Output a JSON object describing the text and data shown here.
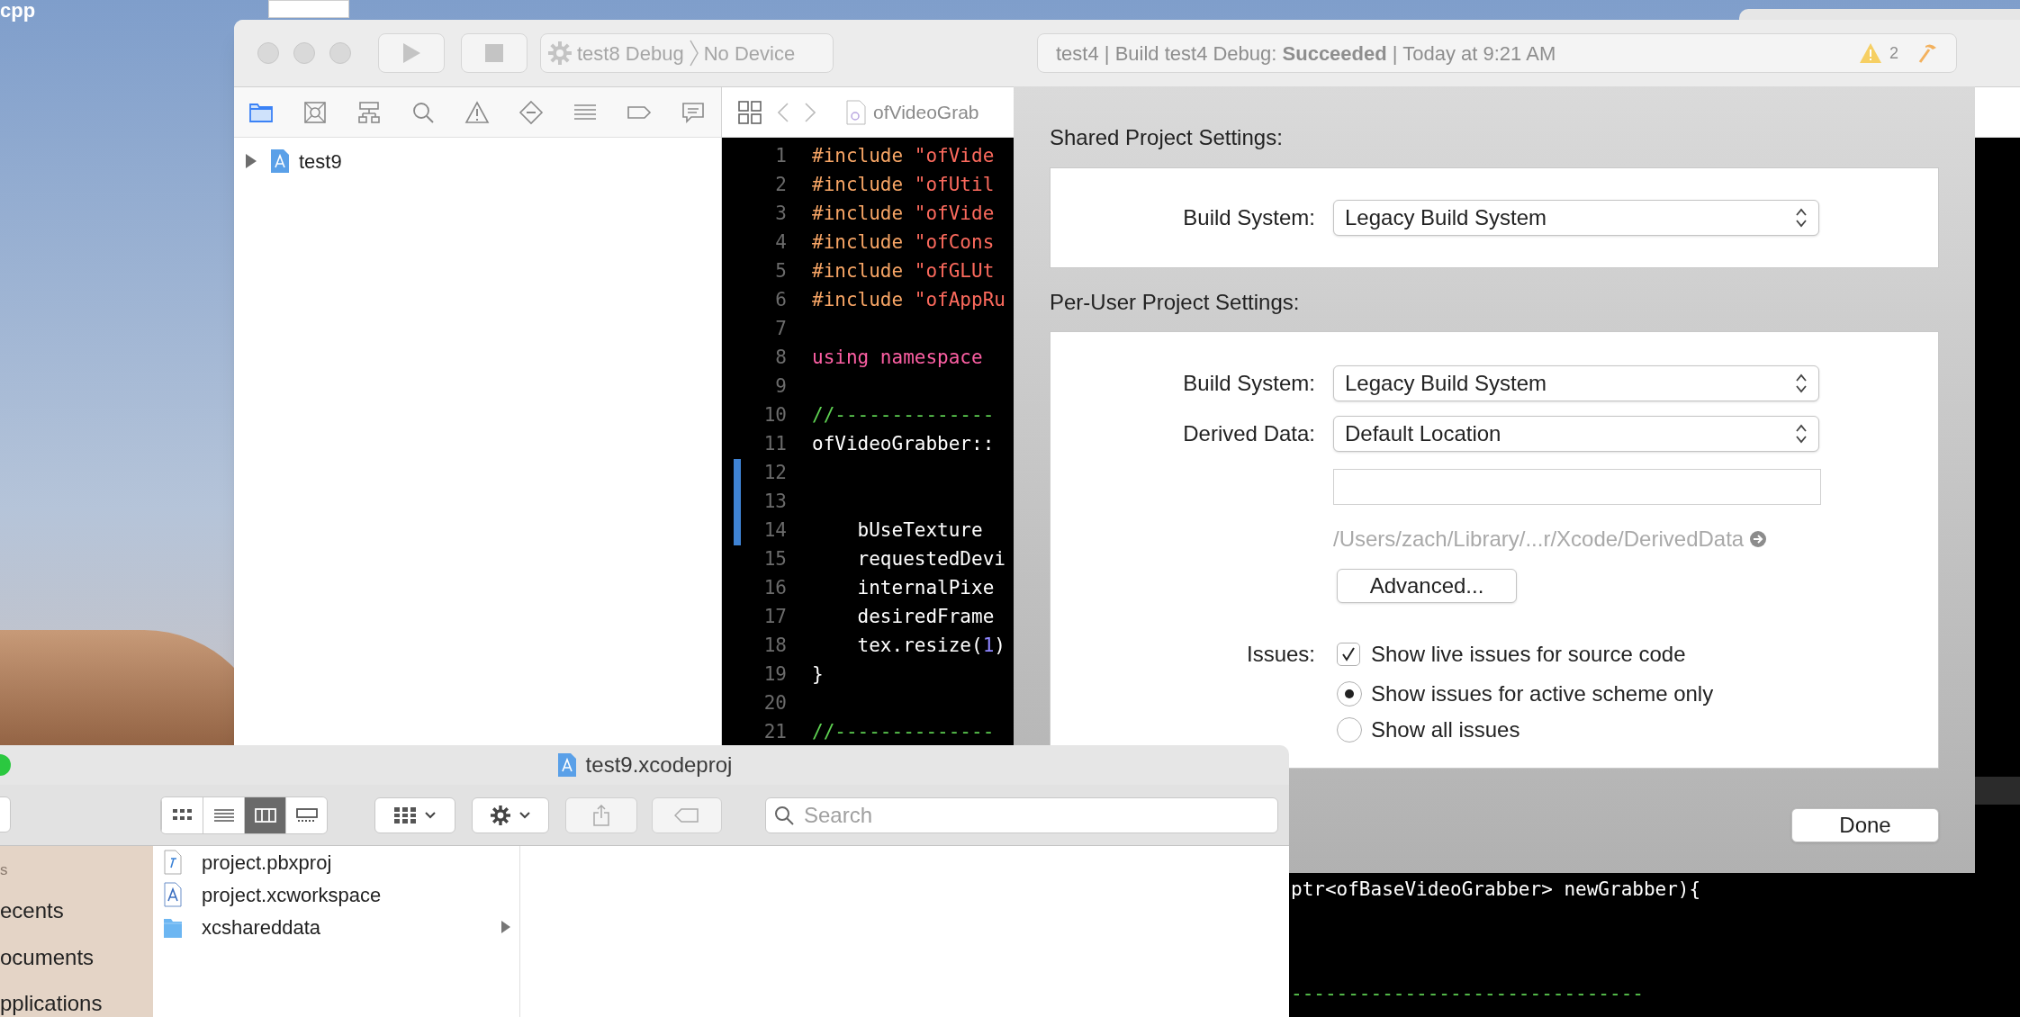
{
  "desktop": {
    "icon_label": "cpp"
  },
  "xcode": {
    "toolbar": {
      "scheme": "test8 Debug",
      "destination": "No Device",
      "activity": "test4 | Build test4 Debug: **Succeeded** | Today at 9:21 AM",
      "warning_count": "2"
    },
    "navigator_tabs": [
      {
        "kind": "folder",
        "selected": true
      },
      {
        "kind": "square-x",
        "selected": false
      },
      {
        "kind": "hierarchy",
        "selected": false
      },
      {
        "kind": "search",
        "selected": false
      },
      {
        "kind": "warning",
        "selected": false
      },
      {
        "kind": "diamond",
        "selected": false
      },
      {
        "kind": "list",
        "selected": false
      },
      {
        "kind": "tag",
        "selected": false
      },
      {
        "kind": "bubble",
        "selected": false
      }
    ],
    "navigator_tree": [
      {
        "label": "test9",
        "expanded": false
      }
    ],
    "jump_bar": {
      "file": "ofVideoGrab"
    },
    "code_lines": [
      {
        "number": "1",
        "changed": false,
        "tokens": [
          {
            "text": "#include",
            "kind": "directive"
          },
          {
            "text": " \"ofVide",
            "kind": "string"
          }
        ]
      },
      {
        "number": "2",
        "changed": false,
        "tokens": [
          {
            "text": "#include",
            "kind": "directive"
          },
          {
            "text": " \"ofUtil",
            "kind": "string"
          }
        ]
      },
      {
        "number": "3",
        "changed": false,
        "tokens": [
          {
            "text": "#include",
            "kind": "directive"
          },
          {
            "text": " \"ofVide",
            "kind": "string"
          }
        ]
      },
      {
        "number": "4",
        "changed": false,
        "tokens": [
          {
            "text": "#include",
            "kind": "directive"
          },
          {
            "text": " \"ofCons",
            "kind": "string"
          }
        ]
      },
      {
        "number": "5",
        "changed": false,
        "tokens": [
          {
            "text": "#include",
            "kind": "directive"
          },
          {
            "text": " \"ofGLUt",
            "kind": "string"
          }
        ]
      },
      {
        "number": "6",
        "changed": false,
        "tokens": [
          {
            "text": "#include",
            "kind": "directive"
          },
          {
            "text": " \"ofAppRu",
            "kind": "string"
          }
        ]
      },
      {
        "number": "7",
        "changed": false
      },
      {
        "number": "8",
        "changed": false,
        "tokens": [
          {
            "text": "using namespace",
            "kind": "keyword"
          }
        ]
      },
      {
        "number": "9",
        "changed": false
      },
      {
        "number": "10",
        "changed": false,
        "tokens": [
          {
            "text": "//--------------",
            "kind": "comment"
          }
        ]
      },
      {
        "number": "11",
        "changed": false,
        "tokens": [
          {
            "text": "ofVideoGrabber::",
            "kind": "plain"
          }
        ]
      },
      {
        "number": "12",
        "changed": true
      },
      {
        "number": "13",
        "changed": true
      },
      {
        "number": "14",
        "changed": true,
        "tokens": [
          {
            "text": "    bUseTexture",
            "kind": "plain"
          }
        ]
      },
      {
        "number": "15",
        "changed": false,
        "tokens": [
          {
            "text": "    requestedDevi",
            "kind": "plain"
          }
        ]
      },
      {
        "number": "16",
        "changed": false,
        "tokens": [
          {
            "text": "    internalPixe",
            "kind": "plain"
          }
        ]
      },
      {
        "number": "17",
        "changed": false,
        "tokens": [
          {
            "text": "    desiredFrame",
            "kind": "plain"
          }
        ]
      },
      {
        "number": "18",
        "changed": false,
        "tokens": [
          {
            "text": "    tex.resize(",
            "kind": "plain"
          },
          {
            "text": "1",
            "kind": "number"
          },
          {
            "text": ")",
            "kind": "plain"
          }
        ]
      },
      {
        "number": "19",
        "changed": false,
        "tokens": [
          {
            "text": "}",
            "kind": "plain"
          }
        ]
      },
      {
        "number": "20",
        "changed": false
      },
      {
        "number": "21",
        "changed": false,
        "tokens": [
          {
            "text": "//--------------",
            "kind": "comment"
          }
        ]
      }
    ],
    "lower_code_lines": [
      {
        "text": "ptr<ofBaseVideoGrabber> newGrabber){",
        "kind": "plain"
      },
      {
        "text": "-------------------------------",
        "kind": "comment"
      }
    ]
  },
  "project_settings_sheet": {
    "shared_title": "Shared Project Settings:",
    "shared_build_system": {
      "label": "Build System:",
      "value": "Legacy Build System"
    },
    "per_user_title": "Per-User Project Settings:",
    "per_user_build_system": {
      "label": "Build System:",
      "value": "Legacy Build System"
    },
    "derived_data": {
      "label": "Derived Data:",
      "value": "Default Location",
      "path": "/Users/zach/Library/...r/Xcode/DerivedData"
    },
    "advanced_button": "Advanced...",
    "issues_label": "Issues:",
    "live_issues": {
      "label": "Show live issues for source code",
      "checked": true
    },
    "issue_scope": [
      {
        "label": "Show issues for active scheme only",
        "selected": true
      },
      {
        "label": "Show all issues",
        "selected": false
      }
    ],
    "done_button": "Done"
  },
  "finder": {
    "title": "test9.xcodeproj",
    "view_modes": [
      {
        "kind": "icons",
        "selected": false
      },
      {
        "kind": "list",
        "selected": false
      },
      {
        "kind": "columns",
        "selected": true
      },
      {
        "kind": "gallery",
        "selected": false
      }
    ],
    "search_placeholder": "Search",
    "sidebar": [
      {
        "label": "s",
        "kind": "heading"
      },
      {
        "label": "ecents",
        "kind": "item"
      },
      {
        "label": "ocuments",
        "kind": "item"
      },
      {
        "label": "pplications",
        "kind": "item"
      }
    ],
    "files": [
      {
        "name": "project.pbxproj",
        "kind": "file"
      },
      {
        "name": "project.xcworkspace",
        "kind": "workspace"
      },
      {
        "name": "xcshareddata",
        "kind": "folder"
      }
    ]
  }
}
